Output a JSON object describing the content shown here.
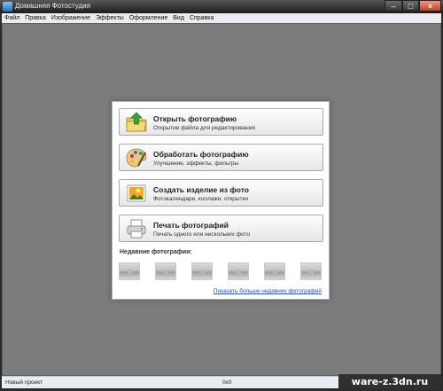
{
  "window": {
    "title": "Домашняя Фотостудия"
  },
  "menu": {
    "items": [
      "Файл",
      "Правка",
      "Изображение",
      "Эффекты",
      "Оформление",
      "Вид",
      "Справка"
    ]
  },
  "dialog": {
    "actions": [
      {
        "title": "Открыть фотографию",
        "subtitle": "Открытие файла для редактирования",
        "icon": "folder-open-icon"
      },
      {
        "title": "Обработать фотографию",
        "subtitle": "Улучшение, эффекты, фильтры",
        "icon": "palette-icon"
      },
      {
        "title": "Создать изделие из фото",
        "subtitle": "Фотокалендари, коллажи, открытки",
        "icon": "picture-icon"
      },
      {
        "title": "Печать фотографий",
        "subtitle": "Печать одного или нескольких фото",
        "icon": "printer-icon"
      }
    ],
    "recent_label": "Недавние фотографии:",
    "more_link": "Показать больше недавних фотографий"
  },
  "status": {
    "project": "Новый проект",
    "dimensions": "0x0"
  },
  "watermark": "ware-z.3dn.ru",
  "colors": {
    "workspace": "#7c7c7c",
    "close_button": "#c44125",
    "link": "#1a4fc4"
  }
}
